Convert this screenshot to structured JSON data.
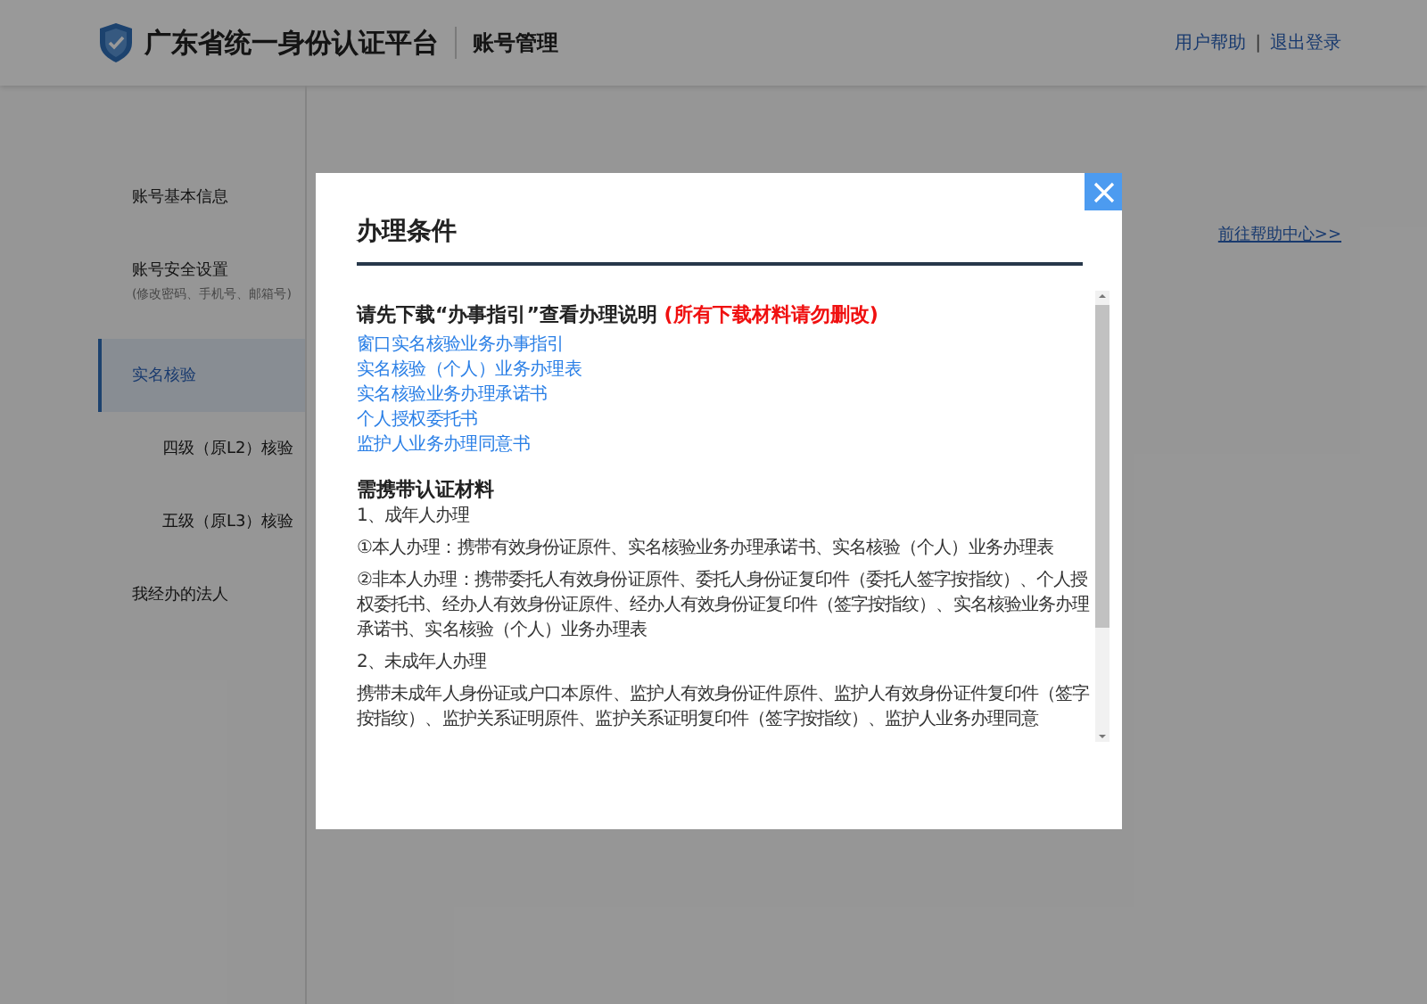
{
  "header": {
    "title": "广东省统一身份认证平台",
    "section": "账号管理",
    "links": [
      "用户帮助",
      "退出登录"
    ],
    "separator": "|"
  },
  "sidebar": {
    "items": [
      {
        "label": "账号基本信息",
        "selected": false
      },
      {
        "label": "账号安全设置",
        "sublabel": "(修改密码、手机号、邮箱号)",
        "selected": false
      },
      {
        "label": "实名核验",
        "selected": true,
        "children": [
          {
            "label": "四级（原L2）核验"
          },
          {
            "label": "五级（原L3）核验"
          }
        ]
      },
      {
        "label": "我经办的法人",
        "selected": false
      }
    ]
  },
  "main": {
    "help_link": "前往帮助中心>>"
  },
  "modal": {
    "title": "办理条件",
    "intro": {
      "text": "请先下载“办事指引”查看办理说明",
      "note": "(所有下载材料请勿删改)"
    },
    "downloads": [
      "窗口实名核验业务办事指引",
      "实名核验（个人）业务办理表",
      "实名核验业务办理承诺书",
      "个人授权委托书",
      "监护人业务办理同意书"
    ],
    "materials": {
      "title": "需携带认证材料",
      "paragraphs": [
        "1、成年人办理",
        "①本人办理：携带有效身份证原件、实名核验业务办理承诺书、实名核验（个人）业务办理表",
        "②非本人办理：携带委托人有效身份证原件、委托人身份证复印件（委托人签字按指纹）、个人授权委托书、经办人有效身份证原件、经办人有效身份证复印件（签字按指纹）、实名核验业务办理承诺书、实名核验（个人）业务办理表",
        "2、未成年人办理",
        "携带未成年人身份证或户口本原件、监护人有效身份证件原件、监护人有效身份证件复印件（签字按指纹）、监护关系证明原件、监护关系证明复印件（签字按指纹）、监护人业务办理同意"
      ]
    }
  }
}
